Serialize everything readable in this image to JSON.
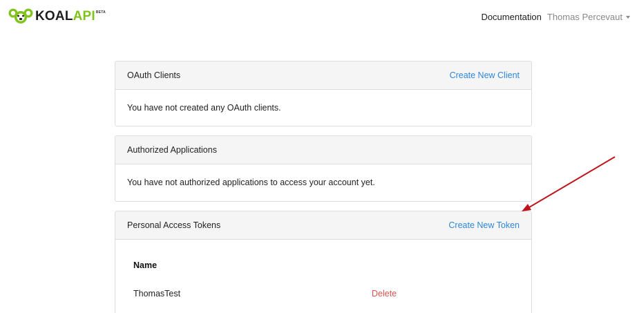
{
  "brand": {
    "text_main": "KOAL",
    "text_accent": "API",
    "badge": "BETA",
    "logo_icon": "koala-logo-icon",
    "accent_color": "#7fc31c"
  },
  "nav": {
    "documentation": "Documentation",
    "user": "Thomas Percevaut"
  },
  "cards": {
    "oauth": {
      "title": "OAuth Clients",
      "action": "Create New Client",
      "body": "You have not created any OAuth clients."
    },
    "authorized": {
      "title": "Authorized Applications",
      "body": "You have not authorized applications to access your account yet."
    },
    "tokens": {
      "title": "Personal Access Tokens",
      "action": "Create New Token",
      "column_name": "Name",
      "rows": [
        {
          "name": "ThomasTest",
          "delete": "Delete"
        }
      ]
    }
  },
  "colors": {
    "link": "#2d86d8",
    "danger": "#d9534f",
    "annotation": "#c0141b"
  }
}
